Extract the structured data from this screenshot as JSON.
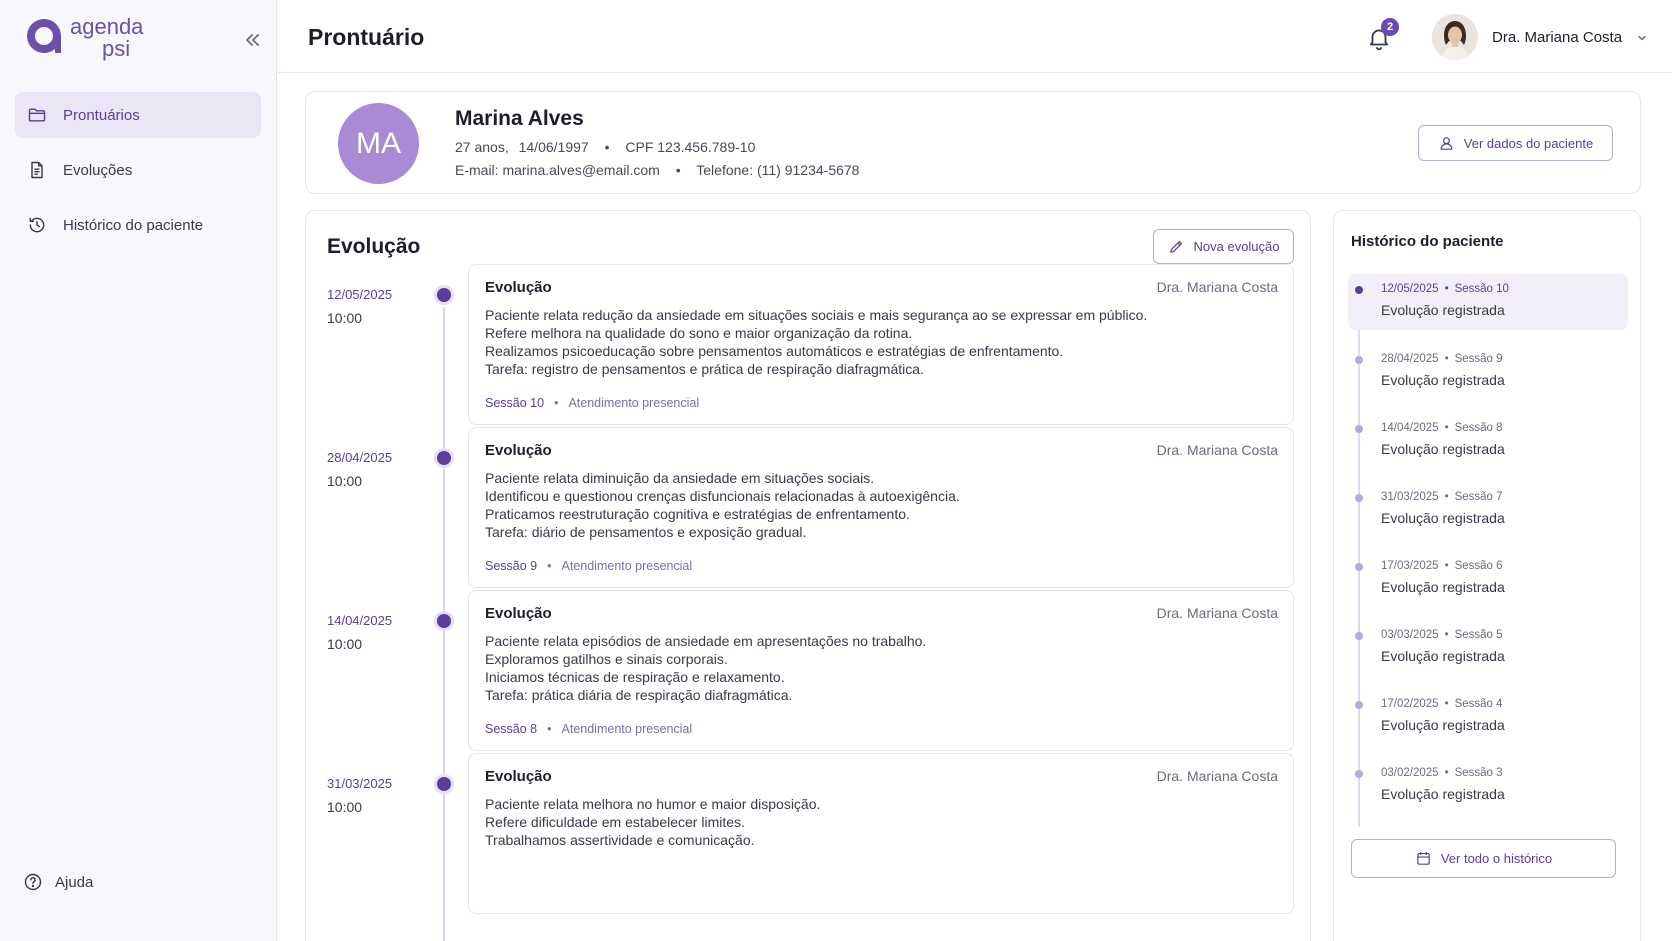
{
  "brand": {
    "line1": "agenda",
    "line2": "psi"
  },
  "sidebar": {
    "items": [
      {
        "label": "Prontuários",
        "icon": "folder-icon",
        "active": true
      },
      {
        "label": "Evoluções",
        "icon": "document-icon",
        "active": false
      },
      {
        "label": "Histórico do paciente",
        "icon": "history-icon",
        "active": false
      }
    ],
    "help_label": "Ajuda"
  },
  "header": {
    "title": "Prontuário",
    "notifications_count": "2",
    "user_name": "Dra. Mariana Costa"
  },
  "patient": {
    "initials": "MA",
    "name": "Marina Alves",
    "age": "27 anos,",
    "birth_date": "14/06/1997",
    "cpf": "CPF 123.456.789-10",
    "email": "E-mail: marina.alves@email.com",
    "phone": "Telefone: (11) 91234-5678",
    "view_button": "Ver dados do paciente"
  },
  "evolution": {
    "title": "Evolução",
    "new_button": "Nova evolução",
    "entries": [
      {
        "date": "12/05/2025",
        "time": "10:00",
        "title": "Evolução",
        "author": "Dra. Mariana Costa",
        "lines": [
          "Paciente relata redução da ansiedade em situações sociais e mais segurança ao se expressar em público.",
          "Refere melhora na qualidade do sono e maior organização da rotina.",
          "Realizamos psicoeducação sobre pensamentos automáticos e estratégias de enfrentamento.",
          "Tarefa: registro de pensamentos e prática de respiração diafragmática."
        ],
        "session": "Sessão 10",
        "mode": "Atendimento presencial"
      },
      {
        "date": "28/04/2025",
        "time": "10:00",
        "title": "Evolução",
        "author": "Dra. Mariana Costa",
        "lines": [
          "Paciente relata diminuição da ansiedade em situações sociais.",
          "Identificou e questionou crenças disfuncionais relacionadas à autoexigência.",
          "Praticamos reestruturação cognitiva e estratégias de enfrentamento.",
          "Tarefa: diário de pensamentos e exposição gradual."
        ],
        "session": "Sessão 9",
        "mode": "Atendimento presencial"
      },
      {
        "date": "14/04/2025",
        "time": "10:00",
        "title": "Evolução",
        "author": "Dra. Mariana Costa",
        "lines": [
          "Paciente relata episódios de ansiedade em apresentações no trabalho.",
          "Exploramos gatilhos e sinais corporais.",
          "Iniciamos técnicas de respiração e relaxamento.",
          "Tarefa: prática diária de respiração diafragmática."
        ],
        "session": "Sessão 8",
        "mode": "Atendimento presencial"
      },
      {
        "date": "31/03/2025",
        "time": "10:00",
        "title": "Evolução",
        "author": "Dra. Mariana Costa",
        "lines": [
          "Paciente relata melhora no humor e maior disposição.",
          "Refere dificuldade em estabelecer limites.",
          "Trabalhamos assertividade e comunicação."
        ],
        "session": "",
        "mode": ""
      }
    ]
  },
  "history": {
    "title": "Histórico do paciente",
    "items": [
      {
        "date": "12/05/2025",
        "session": "Sessão 10",
        "text": "Evolução registrada",
        "active": true
      },
      {
        "date": "28/04/2025",
        "session": "Sessão 9",
        "text": "Evolução registrada",
        "active": false
      },
      {
        "date": "14/04/2025",
        "session": "Sessão 8",
        "text": "Evolução registrada",
        "active": false
      },
      {
        "date": "31/03/2025",
        "session": "Sessão 7",
        "text": "Evolução registrada",
        "active": false
      },
      {
        "date": "17/03/2025",
        "session": "Sessão 6",
        "text": "Evolução registrada",
        "active": false
      },
      {
        "date": "03/03/2025",
        "session": "Sessão 5",
        "text": "Evolução registrada",
        "active": false
      },
      {
        "date": "17/02/2025",
        "session": "Sessão 4",
        "text": "Evolução registrada",
        "active": false
      },
      {
        "date": "03/02/2025",
        "session": "Sessão 3",
        "text": "Evolução registrada",
        "active": false
      }
    ],
    "view_all_button": "Ver todo o histórico"
  },
  "colors": {
    "accent": "#5b3d9c",
    "accent_light": "#ebe6f5",
    "avatar_bg": "#a88bd4",
    "badge": "#6a48b8"
  }
}
